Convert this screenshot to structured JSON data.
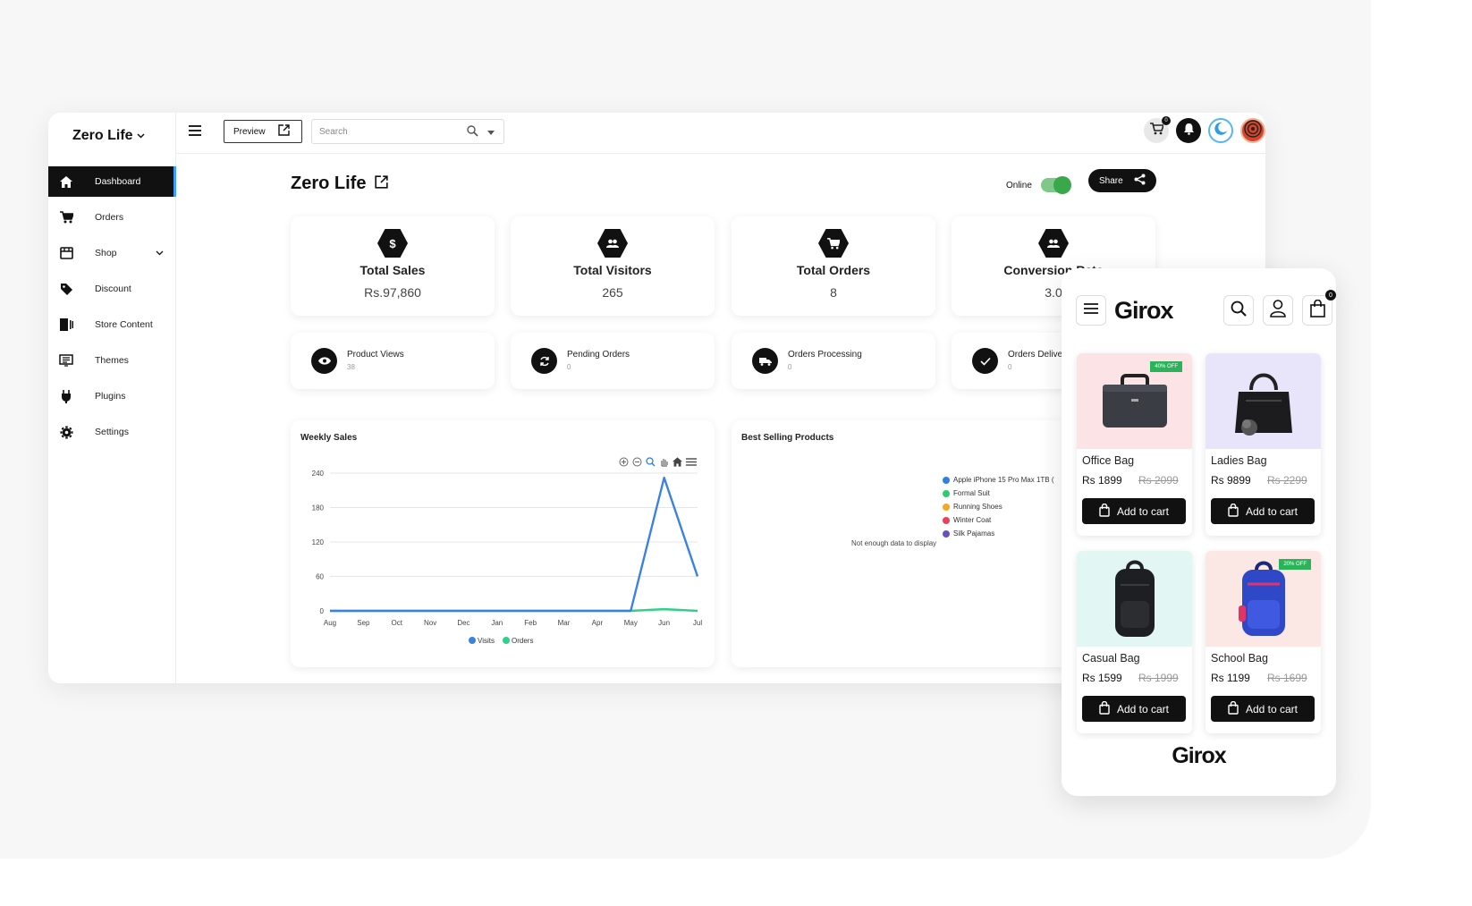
{
  "sidebar": {
    "brand": "Zero Life",
    "items": [
      {
        "label": "Dashboard",
        "icon": "home-icon"
      },
      {
        "label": "Orders",
        "icon": "cart-icon"
      },
      {
        "label": "Shop",
        "icon": "store-icon"
      },
      {
        "label": "Discount",
        "icon": "tag-icon"
      },
      {
        "label": "Store Content",
        "icon": "content-icon"
      },
      {
        "label": "Themes",
        "icon": "themes-icon"
      },
      {
        "label": "Plugins",
        "icon": "plug-icon"
      },
      {
        "label": "Settings",
        "icon": "gear-icon"
      }
    ]
  },
  "topbar": {
    "preview_label": "Preview",
    "search_placeholder": "Search",
    "cart_count": "0"
  },
  "main": {
    "title": "Zero Life",
    "online_label": "Online",
    "share_label": "Share",
    "stats": [
      {
        "label": "Total Sales",
        "value": "Rs.97,860",
        "icon": "$"
      },
      {
        "label": "Total Visitors",
        "value": "265"
      },
      {
        "label": "Total Orders",
        "value": "8"
      },
      {
        "label": "Conversion Rate",
        "value": "3.0"
      }
    ],
    "minis": [
      {
        "label": "Product Views",
        "value": "38"
      },
      {
        "label": "Pending Orders",
        "value": "0"
      },
      {
        "label": "Orders Processing",
        "value": "0"
      },
      {
        "label": "Orders Delivered",
        "value": "0"
      }
    ]
  },
  "weekly": {
    "title": "Weekly Sales"
  },
  "best": {
    "title": "Best Selling Products",
    "legend": [
      "Apple iPhone 15 Pro Max 1TB (",
      "Formal Suit",
      "Running Shoes",
      "Winter Coat",
      "Silk Pajamas"
    ],
    "legend_colors": [
      "#2f7fe0",
      "#2ecc71",
      "#f5a623",
      "#e8415a",
      "#6a4fc1"
    ],
    "empty_text": "Not enough data to display"
  },
  "chart_data": {
    "type": "line",
    "title": "Weekly Sales",
    "categories": [
      "Aug",
      "Sep",
      "Oct",
      "Nov",
      "Dec",
      "Jan",
      "Feb",
      "Mar",
      "Apr",
      "May",
      "Jun",
      "Jul"
    ],
    "series": [
      {
        "name": "Visits",
        "color": "#3b82e0",
        "values": [
          0,
          0,
          0,
          0,
          0,
          0,
          0,
          0,
          0,
          0,
          232,
          60
        ]
      },
      {
        "name": "Orders",
        "color": "#2fd08a",
        "values": [
          0,
          0,
          0,
          0,
          0,
          0,
          0,
          0,
          0,
          0,
          3,
          0
        ]
      }
    ],
    "yticks": [
      0,
      60,
      120,
      180,
      240
    ],
    "ylim": [
      0,
      240
    ],
    "grid": true,
    "legend_position": "bottom"
  },
  "mobile": {
    "logo": "Girox",
    "cart_count": "0",
    "products": [
      {
        "name": "Office Bag",
        "price": "Rs 1899",
        "old_price": "Rs 2099",
        "badge": "40% OFF",
        "bg": "#fbe3e6"
      },
      {
        "name": "Ladies Bag",
        "price": "Rs 9899",
        "old_price": "Rs 2299",
        "badge": "",
        "bg": "#e8e5fb"
      },
      {
        "name": "Casual Bag",
        "price": "Rs 1599",
        "old_price": "Rs 1999",
        "badge": "",
        "bg": "#e2f7f3"
      },
      {
        "name": "School Bag",
        "price": "Rs 1199",
        "old_price": "Rs 1699",
        "badge": "20% OFF",
        "bg": "#fbe7e4"
      }
    ],
    "add_to_cart": "Add to cart",
    "footer_logo": "Girox"
  }
}
